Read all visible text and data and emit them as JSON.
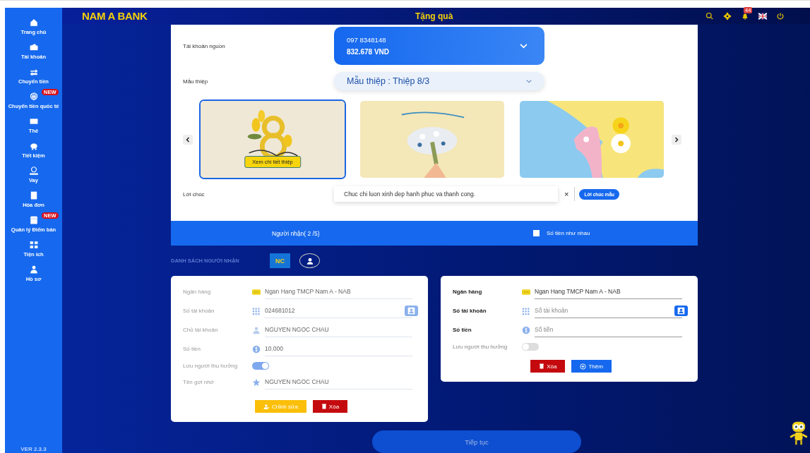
{
  "header": {
    "logo": "NAM A BANK",
    "title": "Tặng quà",
    "notification_count": "44"
  },
  "sidebar": {
    "items": [
      {
        "label": "Trang chủ"
      },
      {
        "label": "Tài khoản"
      },
      {
        "label": "Chuyển tiền"
      },
      {
        "label": "Chuyển tiền quốc tế",
        "badge": "NEW"
      },
      {
        "label": "Thẻ"
      },
      {
        "label": "Tiết kiệm"
      },
      {
        "label": "Vay"
      },
      {
        "label": "Hóa đơn"
      },
      {
        "label": "Quản lý Điểm bán",
        "badge": "NEW"
      },
      {
        "label": "Tiện ích"
      },
      {
        "label": "Hồ sơ"
      }
    ],
    "version": "VER 2.3.3"
  },
  "source_account": {
    "label": "Tài khoản nguồn",
    "phone": "097 8348148",
    "balance": "832.678 VND"
  },
  "card_template": {
    "label": "Mẫu thiệp",
    "value": "Mẫu thiệp : Thiệp 8/3"
  },
  "cards": [
    {
      "kind": "picture",
      "selected": true,
      "button": "Xem chi tiết thiệp"
    },
    {
      "kind": "picture",
      "selected": false
    },
    {
      "kind": "picture",
      "selected": false
    }
  ],
  "greeting": {
    "label": "Lời chúc",
    "value": "Chuc chi luon xinh dep hanh phuc va thanh cong.",
    "clear": "×",
    "sample_button": "Lời chúc mẫu"
  },
  "recipients_bar": {
    "title": "Người nhận( 2 /5)",
    "same_amount": {
      "label": "Số tiền như nhau",
      "checked": false
    }
  },
  "recipient_list": {
    "title": "DANH SÁCH NGƯỜI NHẬN",
    "tabs": [
      {
        "kind": "text",
        "label": "NC",
        "selected": true
      },
      {
        "kind": "avatar",
        "selected": false
      }
    ]
  },
  "recipients": [
    {
      "disabled": true,
      "fields": [
        {
          "kind": "bank",
          "label": "Ngân hàng",
          "value": "Ngan Hang TMCP Nam A - NAB"
        },
        {
          "kind": "account",
          "label": "Số tài khoản",
          "value": "024681012"
        },
        {
          "kind": "holder",
          "label": "Chủ tài khoản",
          "value": "NGUYEN NGOC CHAU"
        },
        {
          "kind": "amount",
          "label": "Số tiền",
          "value": "10.000"
        },
        {
          "kind": "toggle",
          "label": "Lưu người thụ hưởng",
          "on": true
        },
        {
          "kind": "nickname",
          "label": "Tên gợi nhớ",
          "value": "NGUYEN NGOC CHAU"
        }
      ],
      "buttons": [
        {
          "kind": "edit",
          "label": "Chỉnh sửa"
        },
        {
          "kind": "delete",
          "label": "Xóa"
        }
      ]
    },
    {
      "disabled": false,
      "fields": [
        {
          "kind": "bank",
          "label": "Ngân hàng",
          "value": "Ngan Hang TMCP Nam A - NAB"
        },
        {
          "kind": "account",
          "label": "Số tài khoản",
          "placeholder": "Số tài khoản"
        },
        {
          "kind": "amount",
          "label": "Số tiền",
          "placeholder": "Số tiền"
        },
        {
          "kind": "toggle",
          "label": "Lưu người thụ hưởng",
          "on": false
        }
      ],
      "buttons": [
        {
          "kind": "delete",
          "label": "Xóa"
        },
        {
          "kind": "add",
          "label": "Thêm"
        }
      ]
    }
  ],
  "continue_button": "Tiếp tục"
}
